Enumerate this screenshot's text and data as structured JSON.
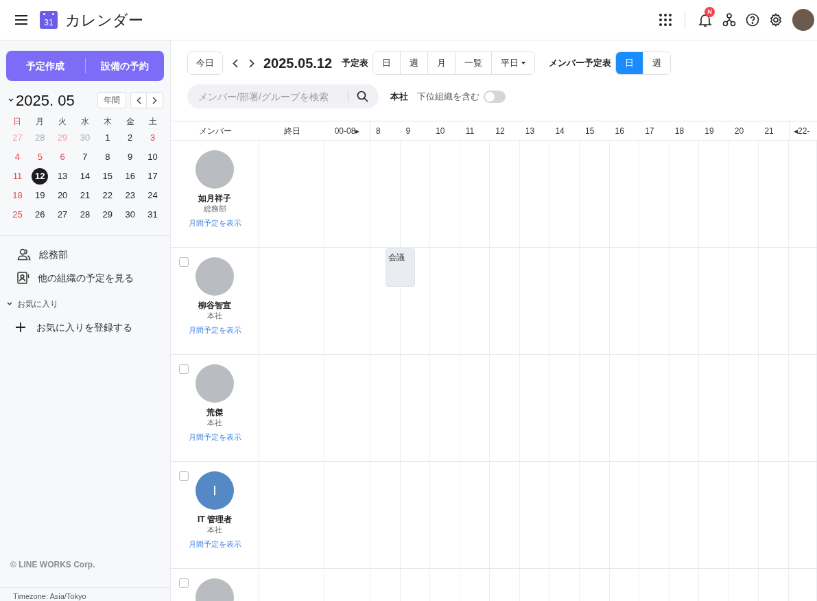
{
  "header": {
    "logo_text": "31",
    "title": "カレンダー",
    "notification_badge": "N"
  },
  "sidebar": {
    "actions": [
      "予定作成",
      "設備の予約"
    ],
    "mini_calendar": {
      "month": "2025. 05",
      "year_button": "年間",
      "weekdays": [
        {
          "label": "日",
          "holiday": true
        },
        {
          "label": "月",
          "holiday": false
        },
        {
          "label": "火",
          "holiday": false
        },
        {
          "label": "水",
          "holiday": false
        },
        {
          "label": "木",
          "holiday": false
        },
        {
          "label": "金",
          "holiday": false
        },
        {
          "label": "土",
          "holiday": false
        }
      ],
      "days": [
        {
          "label": "27",
          "outside": true,
          "holiday": true,
          "selected": false
        },
        {
          "label": "28",
          "outside": true,
          "holiday": false,
          "selected": false
        },
        {
          "label": "29",
          "outside": true,
          "holiday": true,
          "selected": false
        },
        {
          "label": "30",
          "outside": true,
          "holiday": false,
          "selected": false
        },
        {
          "label": "1",
          "outside": false,
          "holiday": false,
          "selected": false
        },
        {
          "label": "2",
          "outside": false,
          "holiday": false,
          "selected": false
        },
        {
          "label": "3",
          "outside": false,
          "holiday": true,
          "selected": false
        },
        {
          "label": "4",
          "outside": false,
          "holiday": true,
          "selected": false
        },
        {
          "label": "5",
          "outside": false,
          "holiday": true,
          "selected": false
        },
        {
          "label": "6",
          "outside": false,
          "holiday": true,
          "selected": false
        },
        {
          "label": "7",
          "outside": false,
          "holiday": false,
          "selected": false
        },
        {
          "label": "8",
          "outside": false,
          "holiday": false,
          "selected": false
        },
        {
          "label": "9",
          "outside": false,
          "holiday": false,
          "selected": false
        },
        {
          "label": "10",
          "outside": false,
          "holiday": false,
          "selected": false
        },
        {
          "label": "11",
          "outside": false,
          "holiday": true,
          "selected": false
        },
        {
          "label": "12",
          "outside": false,
          "holiday": false,
          "selected": true
        },
        {
          "label": "13",
          "outside": false,
          "holiday": false,
          "selected": false
        },
        {
          "label": "14",
          "outside": false,
          "holiday": false,
          "selected": false
        },
        {
          "label": "15",
          "outside": false,
          "holiday": false,
          "selected": false
        },
        {
          "label": "16",
          "outside": false,
          "holiday": false,
          "selected": false
        },
        {
          "label": "17",
          "outside": false,
          "holiday": false,
          "selected": false
        },
        {
          "label": "18",
          "outside": false,
          "holiday": true,
          "selected": false
        },
        {
          "label": "19",
          "outside": false,
          "holiday": false,
          "selected": false
        },
        {
          "label": "20",
          "outside": false,
          "holiday": false,
          "selected": false
        },
        {
          "label": "21",
          "outside": false,
          "holiday": false,
          "selected": false
        },
        {
          "label": "22",
          "outside": false,
          "holiday": false,
          "selected": false
        },
        {
          "label": "23",
          "outside": false,
          "holiday": false,
          "selected": false
        },
        {
          "label": "24",
          "outside": false,
          "holiday": false,
          "selected": false
        },
        {
          "label": "25",
          "outside": false,
          "holiday": true,
          "selected": false
        },
        {
          "label": "26",
          "outside": false,
          "holiday": false,
          "selected": false
        },
        {
          "label": "27",
          "outside": false,
          "holiday": false,
          "selected": false
        },
        {
          "label": "28",
          "outside": false,
          "holiday": false,
          "selected": false
        },
        {
          "label": "29",
          "outside": false,
          "holiday": false,
          "selected": false
        },
        {
          "label": "30",
          "outside": false,
          "holiday": false,
          "selected": false
        },
        {
          "label": "31",
          "outside": false,
          "holiday": false,
          "selected": false
        }
      ]
    },
    "links": [
      {
        "kind": "group",
        "label": "総務部"
      },
      {
        "kind": "org",
        "label": "他の組織の予定を見る"
      }
    ],
    "favorites": {
      "label": "お気に入り",
      "expanded": true,
      "add_label": "お気に入りを登録する"
    },
    "copyright": "© LINE WORKS Corp.",
    "timezone": "Timezone: Asia/Tokyo"
  },
  "toolbar": {
    "today": "今日",
    "date": "2025.05.12",
    "schedule_label": "予定表",
    "schedule_views": [
      {
        "label": "日",
        "selected": false
      },
      {
        "label": "週",
        "selected": false
      },
      {
        "label": "月",
        "selected": false
      },
      {
        "label": "一覧",
        "selected": false
      },
      {
        "label": "平日",
        "selected": false,
        "dropdown": true
      }
    ],
    "member_label": "メンバー予定表",
    "member_views": [
      {
        "label": "日",
        "selected": true
      },
      {
        "label": "週",
        "selected": false
      }
    ],
    "search": {
      "placeholder": "メンバー/部署/グループを検索"
    },
    "org": "本社",
    "include_sub": {
      "label": "下位組織を含む",
      "on": false
    }
  },
  "grid": {
    "columns": [
      "メンバー",
      "終日",
      "00-08▸",
      "8",
      "9",
      "10",
      "11",
      "12",
      "13",
      "14",
      "15",
      "16",
      "17",
      "18",
      "19",
      "20",
      "21",
      "◂22-"
    ],
    "members": [
      {
        "name": "如月祥子",
        "dept": "総務部",
        "link": "月間予定を表示",
        "avatar": {
          "kind": "photo"
        }
      },
      {
        "name": "柳谷智宣",
        "dept": "本社",
        "link": "月間予定を表示",
        "avatar": {
          "kind": "photo"
        },
        "checked": false,
        "events": [
          {
            "title": "会議"
          }
        ]
      },
      {
        "name": "荒傑",
        "dept": "本社",
        "link": "月間予定を表示",
        "avatar": {
          "kind": "photo"
        },
        "checked": false
      },
      {
        "name": "IT 管理者",
        "dept": "本社",
        "link": "月間予定を表示",
        "avatar": {
          "kind": "initial",
          "initial": "I"
        },
        "checked": false
      },
      {
        "avatar": {
          "kind": "photo"
        },
        "checked": false
      }
    ]
  }
}
